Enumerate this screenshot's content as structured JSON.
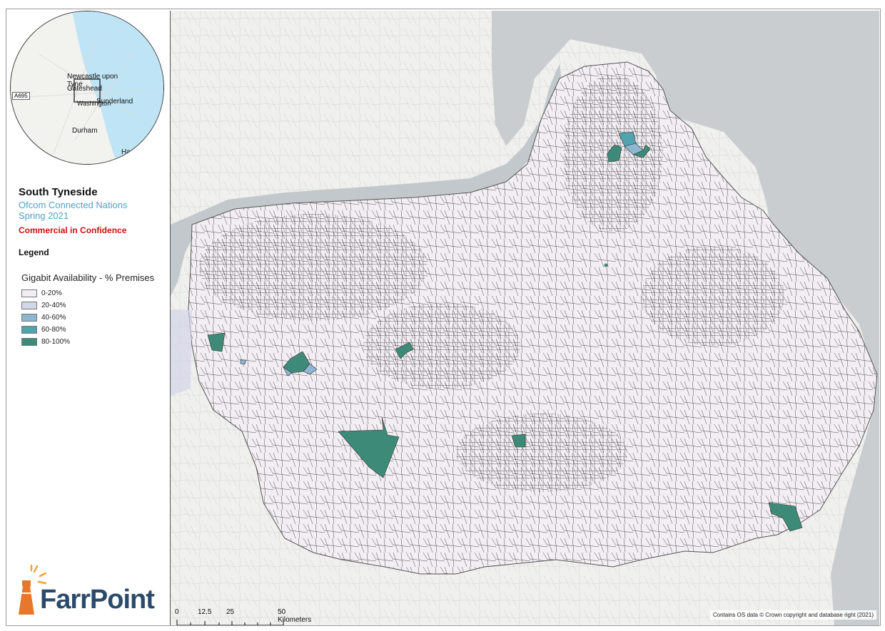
{
  "locator": {
    "labels": [
      "Newcastle upon",
      "Tyne",
      "Gateshead",
      "Washington",
      "Sunderland",
      "Durham",
      "Hartl"
    ],
    "road": "A695"
  },
  "title": "South Tyneside",
  "subtitle1": "Ofcom Connected Nations",
  "subtitle2": "Spring 2021",
  "confidential": "Commercial in Confidence",
  "legend": {
    "title": "Legend",
    "heading": "Gigabit Availability - % Premises",
    "items": [
      {
        "label": "0-20%",
        "color": "#f3eef3"
      },
      {
        "label": "20-40%",
        "color": "#d2d6e8"
      },
      {
        "label": "40-60%",
        "color": "#8db6d2"
      },
      {
        "label": "60-80%",
        "color": "#52a3ad"
      },
      {
        "label": "80-100%",
        "color": "#3e8a78"
      }
    ]
  },
  "scale": {
    "labels": [
      "0",
      "12.5",
      "25",
      "50 Kilometers"
    ]
  },
  "attribution": "Contains OS data © Crown copyright and database right (2021)",
  "logo": {
    "text": "FarrPoint",
    "brand_color": "#2b4a6b",
    "accent": "#e8772b"
  },
  "colors": {
    "sea": "#c9cdd0",
    "land": "#f0f0ee",
    "river": "#c3c8cc"
  }
}
